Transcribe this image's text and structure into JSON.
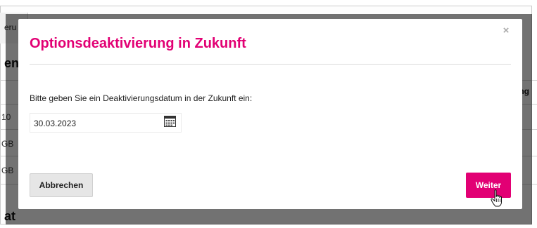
{
  "background": {
    "tab_label": "eru",
    "heading_fragment": "en",
    "column_header_fragment": "ung",
    "row_fragments": [
      "10",
      "GB",
      "GB"
    ],
    "footer_fragment": "at"
  },
  "modal": {
    "title": "Optionsdeaktivierung in Zukunft",
    "close_symbol": "×",
    "prompt": "Bitte geben Sie ein Deaktivierungsdatum in der Zukunft ein:",
    "date_value": "30.03.2023",
    "cancel_label": "Abbrechen",
    "next_label": "Weiter"
  },
  "colors": {
    "accent": "#e20074",
    "overlay": "rgba(0,0,0,0.55)"
  },
  "icons": {
    "calendar": "calendar-icon",
    "close": "close-icon",
    "cursor": "hand-pointer-icon"
  }
}
